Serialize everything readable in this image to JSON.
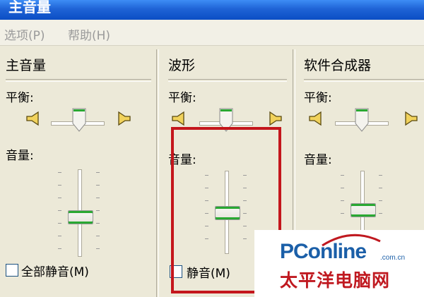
{
  "window": {
    "title": "主音量"
  },
  "menu": {
    "options": "选项(P)",
    "help": "帮助(H)"
  },
  "panes": [
    {
      "title": "主音量",
      "balance_label": "平衡:",
      "volume_label": "音量:",
      "mute_label": "全部静音(M)",
      "mute_checked": false,
      "volume_level": 0.35,
      "balance": 0.5
    },
    {
      "title": "波形",
      "balance_label": "平衡:",
      "volume_label": "音量:",
      "mute_label": "静音(M)",
      "mute_checked": false,
      "volume_level": 0.45,
      "balance": 0.5
    },
    {
      "title": "软件合成器",
      "balance_label": "平衡:",
      "volume_label": "音量:",
      "mute_label": "",
      "mute_checked": false,
      "volume_level": 0.45,
      "balance": 0.5
    }
  ],
  "highlight": {
    "color": "#c4161c"
  },
  "watermark": {
    "brand": "PConline",
    "domain": ".com.cn",
    "subtitle": "太平洋电脑网"
  },
  "icons": {
    "speaker_left": "speaker-left-icon",
    "speaker_right": "speaker-right-icon"
  }
}
